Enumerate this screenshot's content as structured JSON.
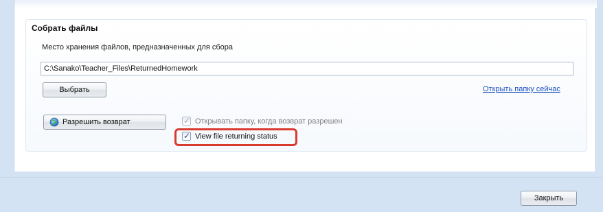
{
  "group": {
    "title": "Собрать файлы",
    "path_label": "Место хранения файлов, предназначенных для сбора",
    "path_value": "C:\\Sanako\\Teacher_Files\\ReturnedHomework",
    "browse_label": "Выбрать",
    "open_folder_link": "Открыть папку сейчас",
    "allow_return_label": "Разрешить возврат",
    "allow_return_icon": "globe-icon",
    "open_folder_checkbox": {
      "label": "Открывать папку, когда возврат разрешен",
      "checked": true,
      "enabled": false
    },
    "view_status_checkbox": {
      "label": "View file returning status",
      "checked": true,
      "enabled": true,
      "highlighted": true
    }
  },
  "footer": {
    "close_label": "Закрыть"
  },
  "colors": {
    "background": "#d4e3f4",
    "link": "#1a4fc2",
    "highlight": "#d93a2f"
  }
}
